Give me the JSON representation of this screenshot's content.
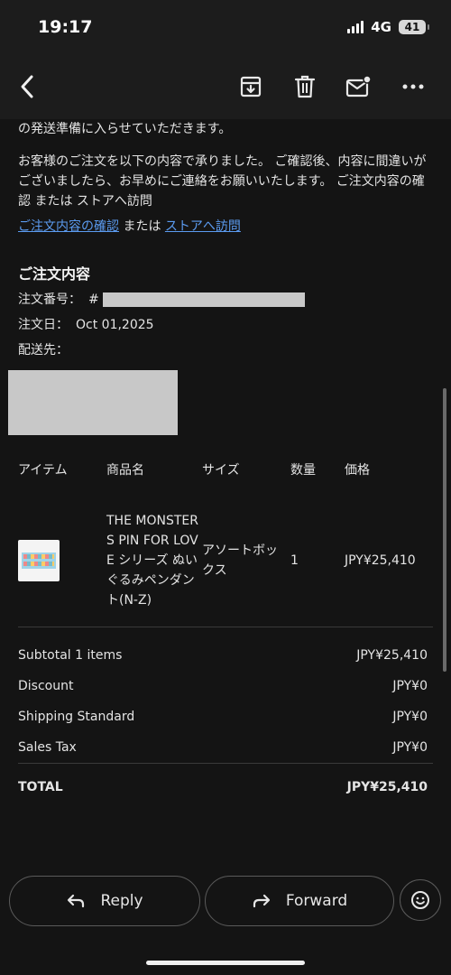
{
  "status": {
    "time": "19:17",
    "network": "4G",
    "battery": "41"
  },
  "toolbar": {
    "back_icon": "chevron-left-icon",
    "archive_icon": "archive-icon",
    "delete_icon": "trash-icon",
    "mark_unread_icon": "mail-unread-icon",
    "more_icon": "more-horizontal-icon"
  },
  "email": {
    "line_partial": "の発送準備に入らせていただきます。",
    "paragraph": "お客様のご注文を以下の内容で承りました。 ご確認後、内容に間違いがございましたら、お早めにご連絡をお願いいたします。 ご注文内容の確認 または ストアへ訪問",
    "link_confirm": "ご注文内容の確認",
    "link_middle": " または ",
    "link_store": "ストアへ訪問",
    "section_title": "ご注文内容",
    "order_number_label": "注文番号：",
    "order_number_prefix": "#",
    "order_date_label": "注文日：",
    "order_date_value": "Oct 01,2025",
    "ship_to_label": "配送先："
  },
  "table": {
    "headers": [
      "アイテム",
      "商品名",
      "サイズ",
      "数量",
      "価格"
    ],
    "rows": [
      {
        "product_name": "THE MONSTERS PIN FOR LOVE シリーズ ぬいぐるみペンダント(N-Z)",
        "size": "アソートボックス",
        "quantity": "1",
        "price": "JPY¥25,410"
      }
    ]
  },
  "summary": [
    {
      "label": "Subtotal 1 items",
      "amount": "JPY¥25,410"
    },
    {
      "label": "Discount",
      "amount": "JPY¥0"
    },
    {
      "label": "Shipping Standard",
      "amount": "JPY¥0"
    },
    {
      "label": "Sales Tax",
      "amount": "JPY¥0"
    }
  ],
  "total": {
    "label": "TOTAL",
    "amount": "JPY¥25,410"
  },
  "actions": {
    "reply_label": "Reply",
    "forward_label": "Forward",
    "reply_icon": "reply-icon",
    "forward_icon": "forward-icon",
    "emoji_icon": "emoji-icon"
  }
}
